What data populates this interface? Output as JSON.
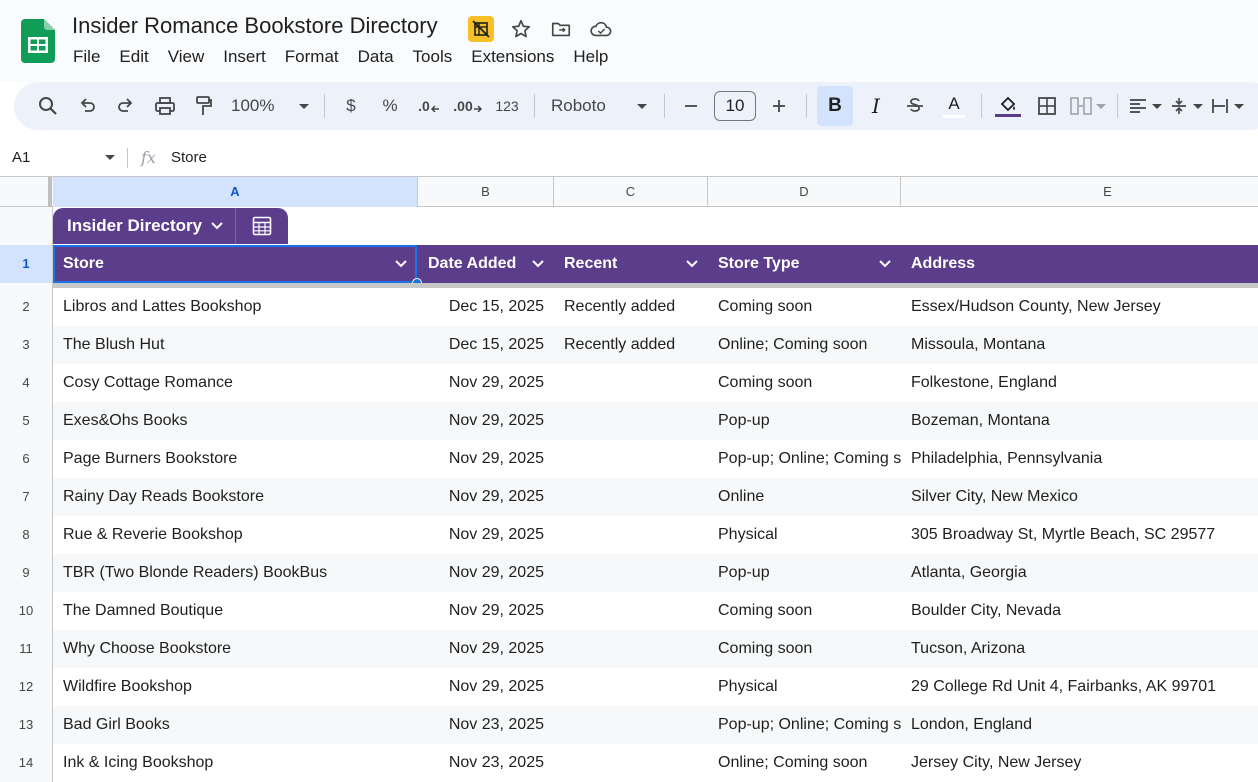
{
  "app": {
    "title": "Insider Romance Bookstore Directory",
    "menu": [
      "File",
      "Edit",
      "View",
      "Insert",
      "Format",
      "Data",
      "Tools",
      "Extensions",
      "Help"
    ]
  },
  "toolbar": {
    "zoom": "100%",
    "currency": "$",
    "percent": "%",
    "decrease_decimal": ".0",
    "increase_decimal": ".00",
    "number_format": "123",
    "font": "Roboto",
    "font_size": "10",
    "bold": "B",
    "italic": "I",
    "text_color": "A"
  },
  "formula_bar": {
    "cell_ref": "A1",
    "value": "Store"
  },
  "columns": [
    "A",
    "B",
    "C",
    "D",
    "E"
  ],
  "table": {
    "name": "Insider Directory",
    "headers": [
      "Store",
      "Date Added",
      "Recent",
      "Store Type",
      "Address"
    ],
    "rows": [
      [
        "Libros and Lattes Bookshop",
        "Dec 15, 2025",
        "Recently added",
        "Coming soon",
        "Essex/Hudson County, New Jersey"
      ],
      [
        "The Blush Hut",
        "Dec 15, 2025",
        "Recently added",
        "Online; Coming soon",
        "Missoula, Montana"
      ],
      [
        "Cosy Cottage Romance",
        "Nov 29, 2025",
        "",
        "Coming soon",
        "Folkestone, England"
      ],
      [
        "Exes&Ohs Books",
        "Nov 29, 2025",
        "",
        "Pop-up",
        "Bozeman, Montana"
      ],
      [
        "Page Burners Bookstore",
        "Nov 29, 2025",
        "",
        "Pop-up; Online; Coming s",
        "Philadelphia, Pennsylvania"
      ],
      [
        "Rainy Day Reads Bookstore",
        "Nov 29, 2025",
        "",
        "Online",
        "Silver City, New Mexico"
      ],
      [
        "Rue & Reverie Bookshop",
        "Nov 29, 2025",
        "",
        "Physical",
        "305 Broadway St, Myrtle Beach, SC 29577"
      ],
      [
        "TBR (Two Blonde Readers) BookBus",
        "Nov 29, 2025",
        "",
        "Pop-up",
        "Atlanta, Georgia"
      ],
      [
        "The Damned Boutique",
        "Nov 29, 2025",
        "",
        "Coming soon",
        "Boulder City, Nevada"
      ],
      [
        "Why Choose Bookstore",
        "Nov 29, 2025",
        "",
        "Coming soon",
        "Tucson, Arizona"
      ],
      [
        "Wildfire Bookshop",
        "Nov 29, 2025",
        "",
        "Physical",
        "29 College Rd Unit 4, Fairbanks, AK 99701"
      ],
      [
        "Bad Girl Books",
        "Nov 23, 2025",
        "",
        "Pop-up; Online; Coming s",
        "London, England"
      ],
      [
        "Ink & Icing Bookshop",
        "Nov 23, 2025",
        "",
        "Online; Coming soon",
        "Jersey City, New Jersey"
      ]
    ]
  },
  "row_numbers": [
    "1",
    "2",
    "3",
    "4",
    "5",
    "6",
    "7",
    "8",
    "9",
    "10",
    "11",
    "12",
    "13",
    "14"
  ],
  "colors": {
    "table_header": "#5b3d8c",
    "selection": "#1a73e8",
    "sheets_green": "#0f9d58"
  }
}
